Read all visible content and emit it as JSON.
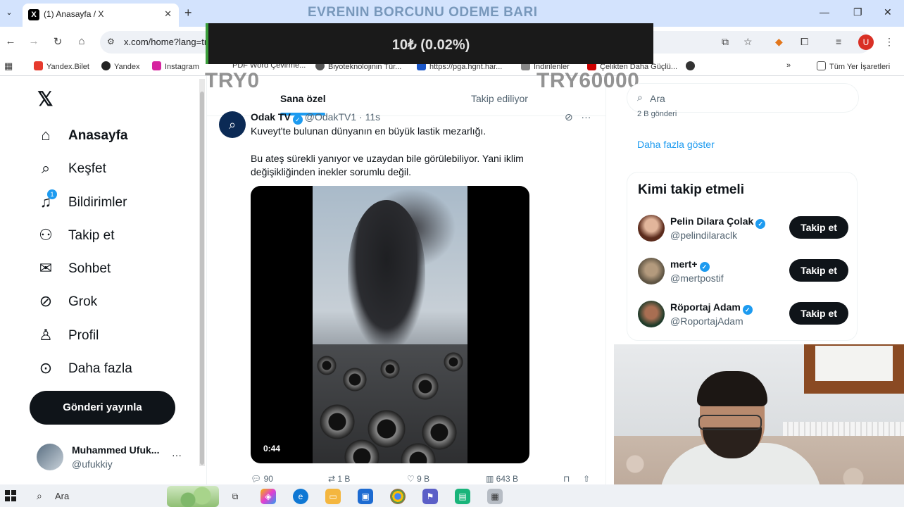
{
  "browser": {
    "tab_title": "(1) Anasayfa / X",
    "url": "x.com/home?lang=tr",
    "overlay_title": "EVRENIN BORCUNU ODEME BARI",
    "profile_initial": "U",
    "bookmarks": [
      "Yandex.Bilet",
      "Yandex",
      "Instagram",
      "PDF Word Çevirme...",
      "Biyoteknolojinin Tür...",
      "https://pga.hgnt.har...",
      "İndirilenler",
      "Çelikten Daha Güçlü...",
      "Tüm Yer İşaretleri"
    ]
  },
  "donation_bar": {
    "text": "10₺ (0.02%)",
    "min_label": "TRY0",
    "max_label": "TRY60000",
    "progress_fraction": 0.0002
  },
  "sidebar": {
    "items": [
      {
        "label": "Anasayfa",
        "icon": "home-icon"
      },
      {
        "label": "Keşfet",
        "icon": "search-icon"
      },
      {
        "label": "Bildirimler",
        "icon": "bell-icon",
        "badge": "1"
      },
      {
        "label": "Takip et",
        "icon": "person-add-icon"
      },
      {
        "label": "Sohbet",
        "icon": "mail-icon"
      },
      {
        "label": "Grok",
        "icon": "grok-icon"
      },
      {
        "label": "Profil",
        "icon": "person-icon"
      },
      {
        "label": "Daha fazla",
        "icon": "more-circle-icon"
      }
    ],
    "post_button": "Gönderi yayınla",
    "account": {
      "name": "Muhammed Ufuk...",
      "handle": "@ufukkiy",
      "more": "···"
    }
  },
  "feed": {
    "tabs": [
      "Sana özel",
      "Takip ediliyor"
    ],
    "tweet": {
      "author": "Odak TV",
      "handle": "@OdakTV1 · 11s",
      "line1": "Kuveyt'te bulunan dünyanın en büyük lastik mezarlığı.",
      "line2": "Bu ateş sürekli yanıyor ve uzaydan bile görülebiliyor. Yani iklim değişikliğinden inekler sorumlu değil.",
      "video_time": "0:44",
      "stats": {
        "replies": "90",
        "reposts": "1 B",
        "likes": "9 B",
        "views": "643 B"
      }
    }
  },
  "right": {
    "search_placeholder": "Ara",
    "trend_fragment": "2 B gönderi",
    "show_more": "Daha fazla göster",
    "who_to_follow_title": "Kimi takip etmeli",
    "suggestions": [
      {
        "name": "Pelin Dilara Çolak",
        "handle": "@pelindilaraclk",
        "button": "Takip et"
      },
      {
        "name": "mert+",
        "handle": "@mertpostif",
        "button": "Takip et"
      },
      {
        "name": "Röportaj Adam",
        "handle": "@RoportajAdam",
        "button": "Takip et"
      }
    ]
  },
  "taskbar": {
    "search_label": "Ara"
  }
}
